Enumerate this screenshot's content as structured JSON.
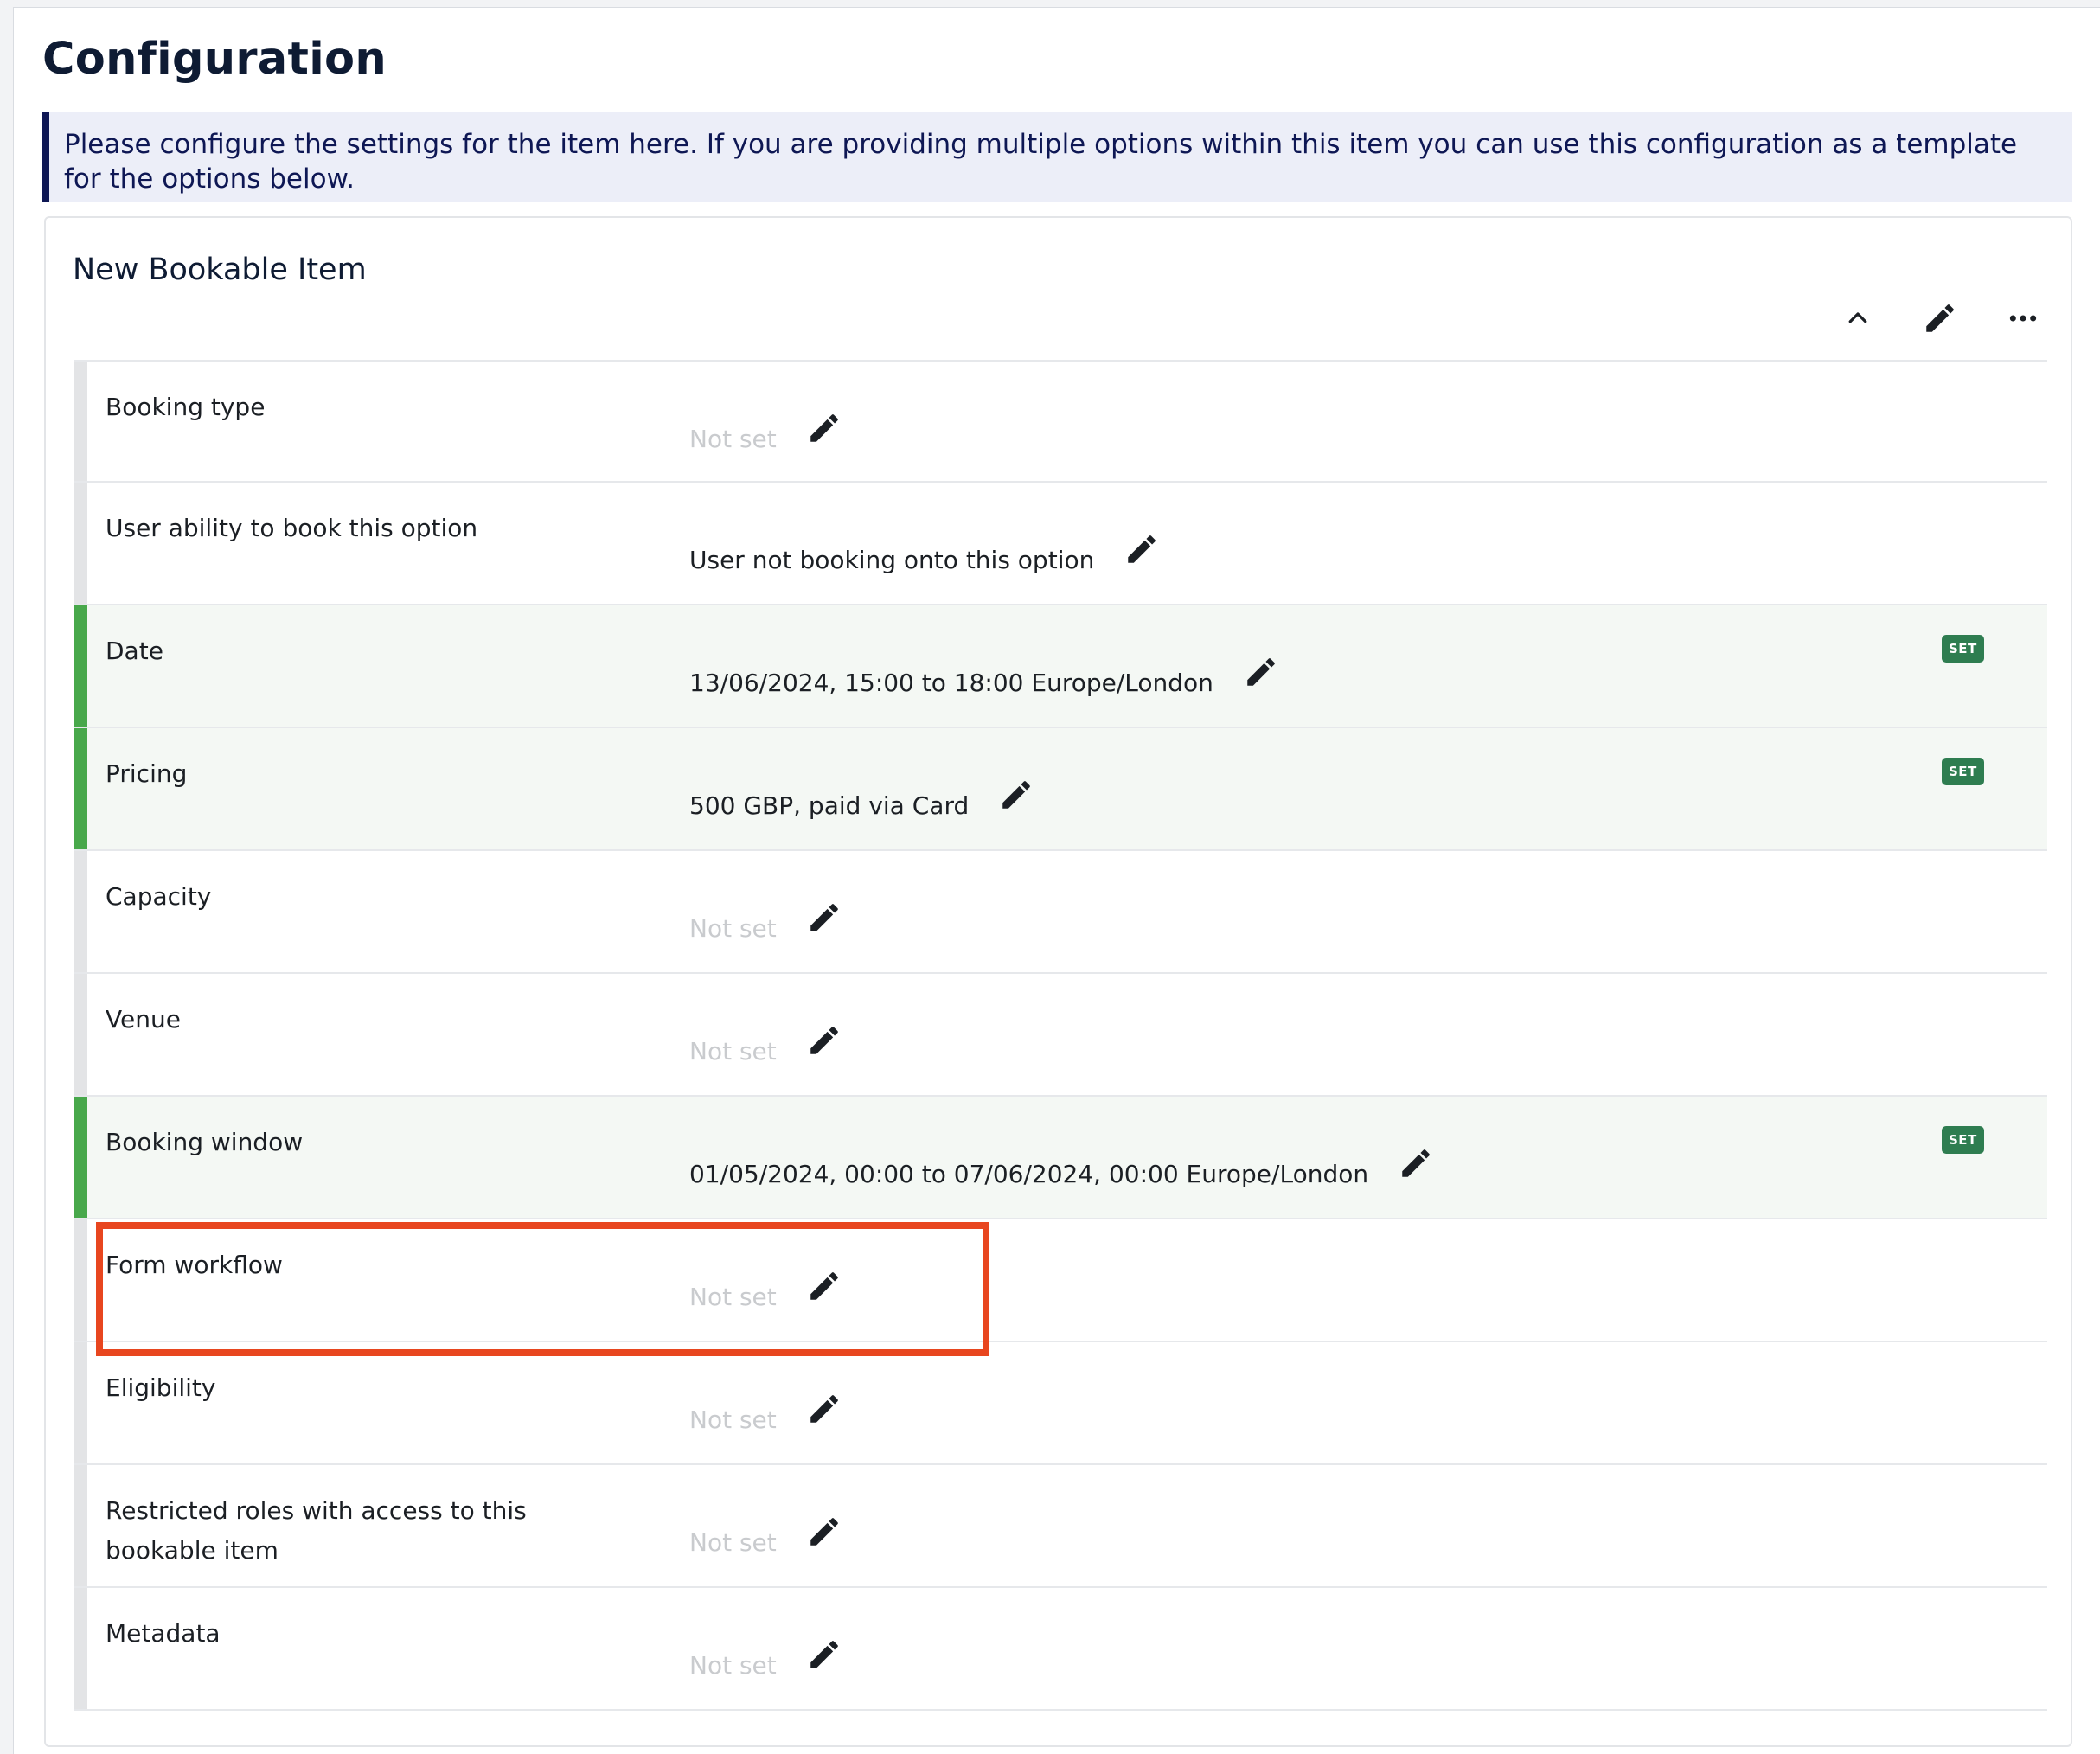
{
  "page": {
    "title": "Configuration",
    "info": "Please configure the settings for the item here. If you are providing multiple options within this item you can use this configuration as a template for the options below."
  },
  "card": {
    "title": "New Bookable Item",
    "toolbar": {
      "collapse_icon": "chevron-up-icon",
      "edit_icon": "pencil-icon",
      "more_icon": "more-horizontal-icon"
    }
  },
  "colors": {
    "set_bar": "#48a84b",
    "unset_bar": "#e3e4e6",
    "badge": "#2e7d50",
    "highlight": "#e8461f",
    "callout_accent": "#0e1754"
  },
  "rows": [
    {
      "label": "Booking type",
      "value": "Not set",
      "is_set": false
    },
    {
      "label": "User ability to book this option",
      "value": "User not booking onto this option",
      "is_set": false
    },
    {
      "label": "Date",
      "value": "13/06/2024, 15:00 to 18:00 Europe/London",
      "is_set": true,
      "badge": "SET"
    },
    {
      "label": "Pricing",
      "value": "500 GBP, paid via Card",
      "is_set": true,
      "badge": "SET"
    },
    {
      "label": "Capacity",
      "value": "Not set",
      "is_set": false
    },
    {
      "label": "Venue",
      "value": "Not set",
      "is_set": false
    },
    {
      "label": "Booking window",
      "value": "01/05/2024, 00:00 to 07/06/2024, 00:00 Europe/London",
      "is_set": true,
      "badge": "SET"
    },
    {
      "label": "Form workflow",
      "value": "Not set",
      "is_set": false
    },
    {
      "label": "Eligibility",
      "value": "Not set",
      "is_set": false
    },
    {
      "label": "Restricted roles with access to this bookable item",
      "value": "Not set",
      "is_set": false
    },
    {
      "label": "Metadata",
      "value": "Not set",
      "is_set": false
    }
  ]
}
